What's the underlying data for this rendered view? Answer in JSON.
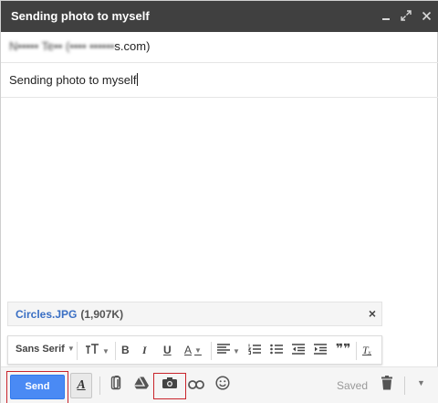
{
  "window": {
    "title": "Sending photo to myself",
    "controls": {
      "minimize": "minimize-icon",
      "popout": "popout-icon",
      "close": "close-icon"
    }
  },
  "to": {
    "visible_text": "s.com)",
    "obscured_text": "N••••• Te•• (•••• ••••••"
  },
  "subject": {
    "value": "Sending photo to myself"
  },
  "attachment": {
    "name": "Circles.JPG",
    "size": "(1,907K)",
    "remove": "×"
  },
  "formatting": {
    "font": "Sans Serif",
    "size_icon": "ᴛT",
    "bold": "B",
    "italic": "I",
    "underline": "U",
    "text_color": "A",
    "align_icon": "≡",
    "numbered_icon": "☰",
    "bullet_icon": "☰",
    "indent_less_icon": "⇤",
    "indent_more_icon": "⇥",
    "quote": "❞❞",
    "clear": "Tₓ"
  },
  "toolbar": {
    "send_label": "Send",
    "saved_label": "Saved",
    "format_glyph": "A",
    "attach_icon": "paperclip-icon",
    "drive_icon": "drive-icon",
    "photo_icon": "camera-icon",
    "link_icon": "link-icon",
    "emoji_icon": "emoji-icon",
    "trash_icon": "trash-icon",
    "more_icon": "chevron-down-icon"
  },
  "colors": {
    "titlebar": "#404040",
    "send": "#4a8af4",
    "highlight": "#c9242b",
    "attachment_link": "#3a6fc4"
  }
}
